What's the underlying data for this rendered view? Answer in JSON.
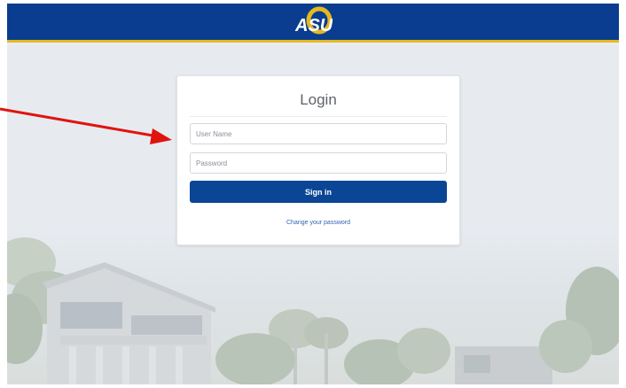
{
  "header": {
    "logo_text": "ASU",
    "bg_color": "#0a3d8f",
    "accent_color": "#e4b820"
  },
  "login": {
    "title": "Login",
    "username_placeholder": "User Name",
    "password_placeholder": "Password",
    "signin_label": "Sign in",
    "change_password_label": "Change your password",
    "button_color": "#0b4595"
  },
  "annotation": {
    "icon": "red-arrow-icon",
    "color": "#e0140f"
  }
}
